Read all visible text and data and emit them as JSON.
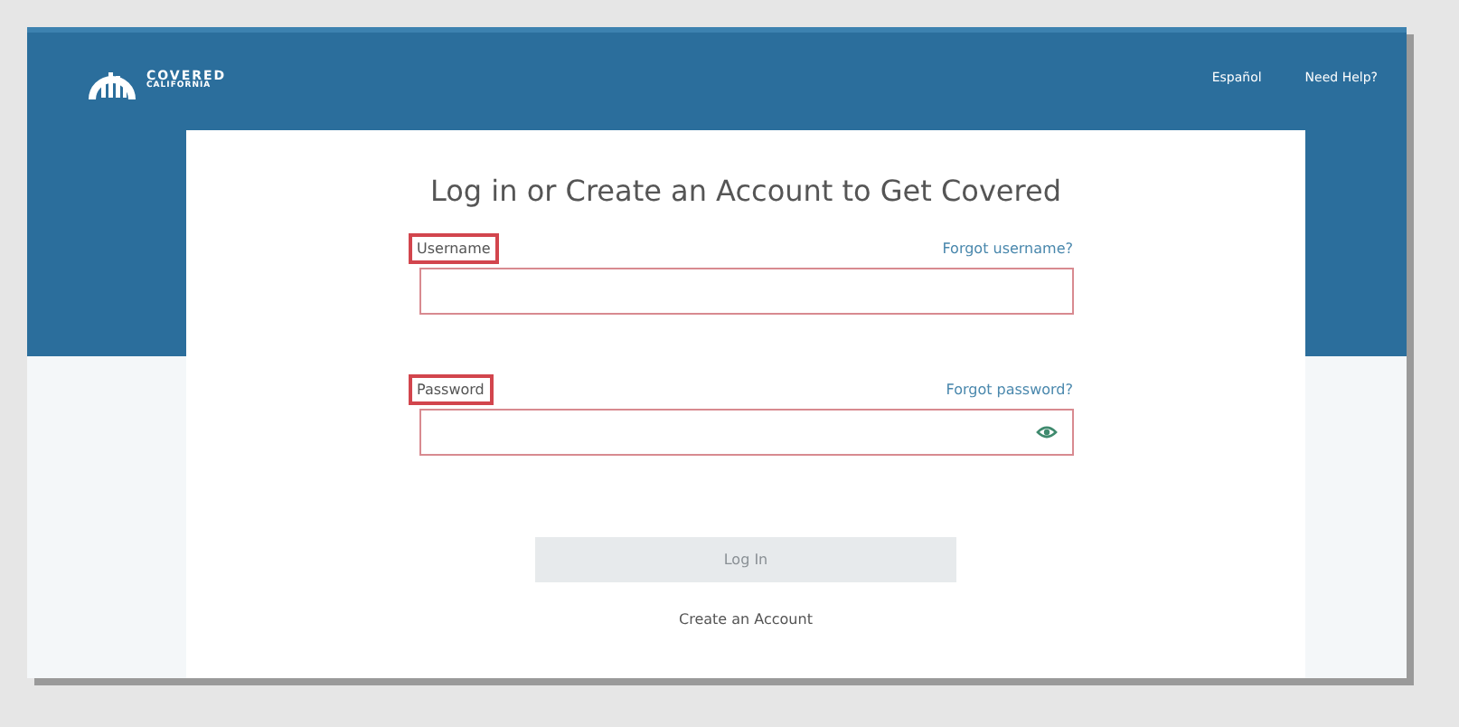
{
  "header": {
    "logo": {
      "line1": "COVERED",
      "line2": "CALIFORNIA"
    },
    "links": [
      "Español",
      "Need Help?"
    ]
  },
  "title": "Log in or Create an Account to Get Covered",
  "fields": [
    {
      "kind": "text",
      "label": "Username",
      "highlighted": true,
      "link": "Forgot username?"
    },
    {
      "kind": "password",
      "label": "Password",
      "highlighted": true,
      "link": "Forgot password?"
    }
  ],
  "submit": {
    "label": "Log In",
    "disabled": true
  },
  "create_link": "Create an Account"
}
